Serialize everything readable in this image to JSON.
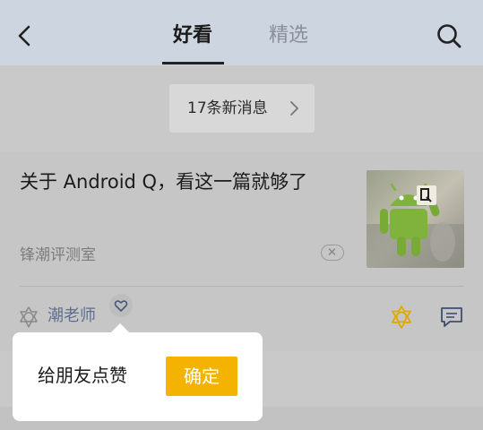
{
  "header": {
    "tabs": [
      {
        "label": "好看",
        "active": true
      },
      {
        "label": "精选",
        "active": false
      }
    ]
  },
  "feed": {
    "new_messages_label": "17条新消息",
    "article": {
      "title": "关于 Android Q，看这一篇就够了",
      "source": "锋潮评测室",
      "author": "潮老师"
    }
  },
  "popup": {
    "text": "给朋友点赞",
    "confirm_label": "确定"
  },
  "colors": {
    "accent": "#f5b301",
    "author_link": "#5f6f8f",
    "header_bg": "#ccd5e0"
  }
}
